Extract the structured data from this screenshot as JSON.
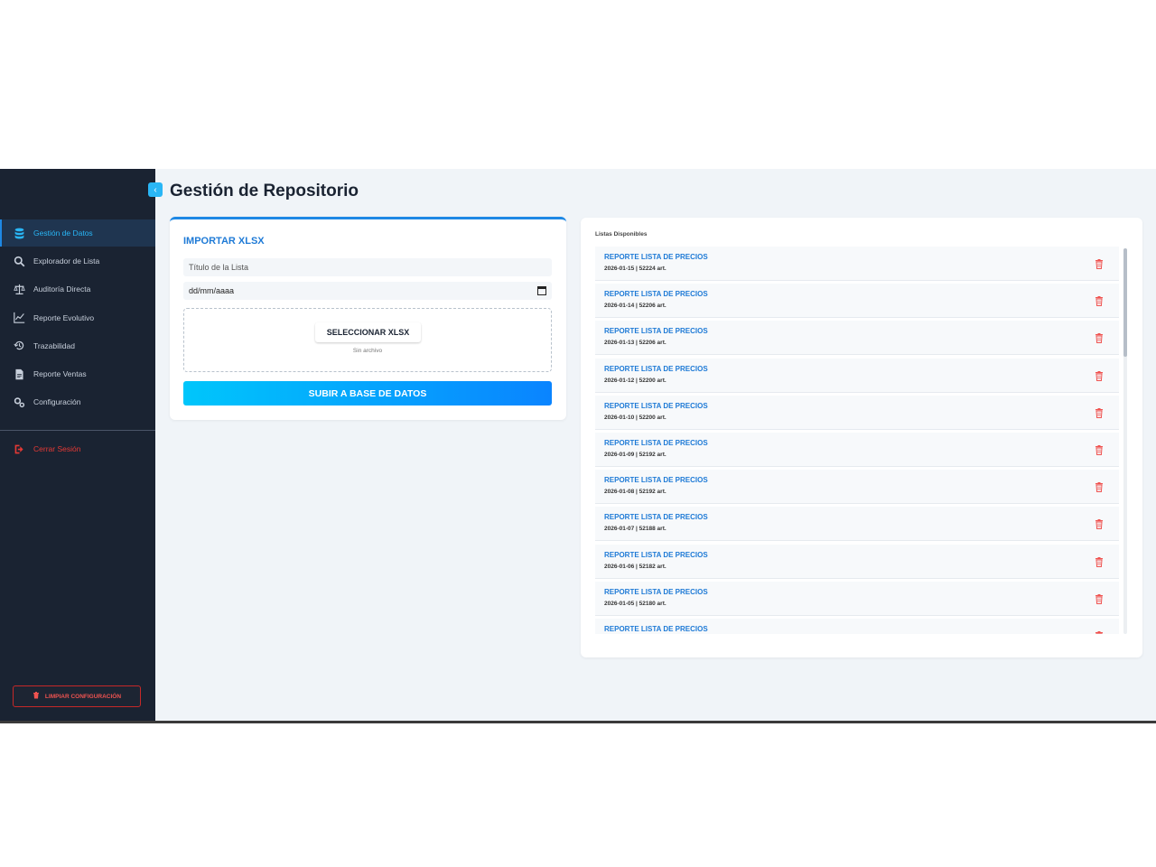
{
  "sidebar": {
    "items": [
      {
        "label": "Gestión de Datos",
        "icon": "database-icon",
        "active": true
      },
      {
        "label": "Explorador de Lista",
        "icon": "search-icon",
        "active": false
      },
      {
        "label": "Auditoría Directa",
        "icon": "scale-icon",
        "active": false
      },
      {
        "label": "Reporte Evolutivo",
        "icon": "line-chart-icon",
        "active": false
      },
      {
        "label": "Trazabilidad",
        "icon": "history-icon",
        "active": false
      },
      {
        "label": "Reporte Ventas",
        "icon": "file-icon",
        "active": false
      },
      {
        "label": "Configuración",
        "icon": "gears-icon",
        "active": false
      }
    ],
    "logout_label": "Cerrar Sesión",
    "clear_label": "LIMPIAR CONFIGURACIÓN"
  },
  "page": {
    "title": "Gestión de Repositorio"
  },
  "import": {
    "title": "IMPORTAR XLSX",
    "list_title_placeholder": "Título de la Lista",
    "date_value": "dd/mm/aaaa",
    "select_label": "SELECCIONAR XLSX",
    "no_file": "Sin archivo",
    "upload_label": "SUBIR A BASE DE DATOS"
  },
  "lists": {
    "title": "Listas Disponibles",
    "items": [
      {
        "name": "REPORTE LISTA DE PRECIOS",
        "meta": "2026-01-15 | 52224 art."
      },
      {
        "name": "REPORTE LISTA DE PRECIOS",
        "meta": "2026-01-14 | 52206 art."
      },
      {
        "name": "REPORTE LISTA DE PRECIOS",
        "meta": "2026-01-13 | 52206 art."
      },
      {
        "name": "REPORTE LISTA DE PRECIOS",
        "meta": "2026-01-12 | 52200 art."
      },
      {
        "name": "REPORTE LISTA DE PRECIOS",
        "meta": "2026-01-10 | 52200 art."
      },
      {
        "name": "REPORTE LISTA DE PRECIOS",
        "meta": "2026-01-09 | 52192 art."
      },
      {
        "name": "REPORTE LISTA DE PRECIOS",
        "meta": "2026-01-08 | 52192 art."
      },
      {
        "name": "REPORTE LISTA DE PRECIOS",
        "meta": "2026-01-07 | 52188 art."
      },
      {
        "name": "REPORTE LISTA DE PRECIOS",
        "meta": "2026-01-06 | 52182 art."
      },
      {
        "name": "REPORTE LISTA DE PRECIOS",
        "meta": "2026-01-05 | 52180 art."
      },
      {
        "name": "REPORTE LISTA DE PRECIOS",
        "meta": ""
      }
    ]
  },
  "colors": {
    "accent": "#1e88e5",
    "sidebar_bg": "#1a2332",
    "danger": "#e53935"
  }
}
